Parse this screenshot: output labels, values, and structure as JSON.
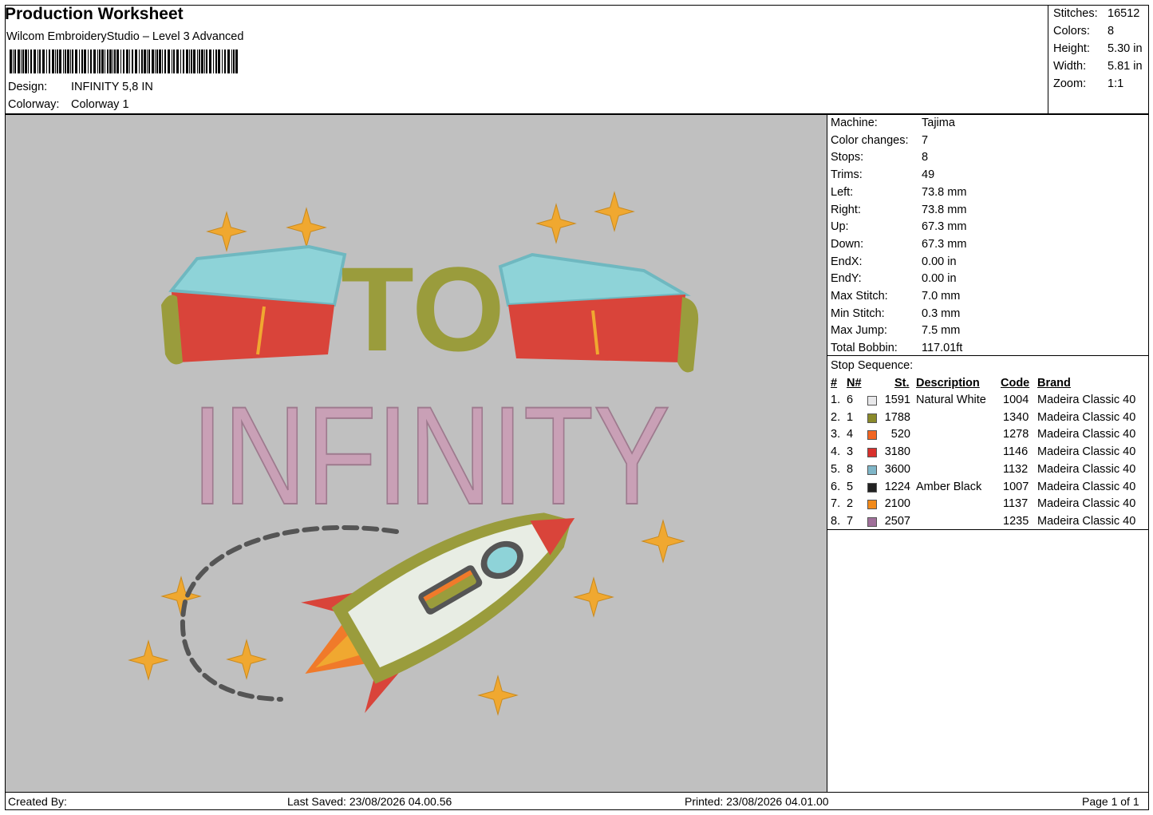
{
  "header": {
    "title": "Production Worksheet",
    "subtitle": "Wilcom EmbroideryStudio – Level 3 Advanced",
    "barcode_text": "*INFINITY 5,8 IN*",
    "design_label": "Design:",
    "design_value": "INFINITY 5,8 IN",
    "colorway_label": "Colorway:",
    "colorway_value": "Colorway 1"
  },
  "summary": [
    {
      "label": "Stitches:",
      "value": "16512"
    },
    {
      "label": "Colors:",
      "value": "8"
    },
    {
      "label": "Height:",
      "value": "5.30 in"
    },
    {
      "label": "Width:",
      "value": "5.81 in"
    },
    {
      "label": "Zoom:",
      "value": "1:1"
    }
  ],
  "design_preview": {
    "text_line1": "TO",
    "text_line2": "INFINITY",
    "background_color": "#c0c0c0",
    "colors": {
      "pink": "#c9a0b6",
      "olive": "#9a9c3c",
      "red": "#d9443a",
      "cyan": "#8ed3d8",
      "gold": "#f0a830",
      "white": "#e8ede4",
      "dark": "#555555",
      "orange": "#f07a2a"
    }
  },
  "machine_info": [
    {
      "label": "Machine:",
      "value": "Tajima"
    },
    {
      "label": "Color changes:",
      "value": "7"
    },
    {
      "label": "Stops:",
      "value": "8"
    },
    {
      "label": "Trims:",
      "value": "49"
    },
    {
      "label": "Left:",
      "value": "73.8 mm"
    },
    {
      "label": "Right:",
      "value": "73.8 mm"
    },
    {
      "label": "Up:",
      "value": "67.3 mm"
    },
    {
      "label": "Down:",
      "value": "67.3 mm"
    },
    {
      "label": "EndX:",
      "value": "0.00 in"
    },
    {
      "label": "EndY:",
      "value": "0.00 in"
    },
    {
      "label": "Max Stitch:",
      "value": "7.0 mm"
    },
    {
      "label": "Min Stitch:",
      "value": "0.3 mm"
    },
    {
      "label": "Max Jump:",
      "value": "7.5 mm"
    },
    {
      "label": "Total Bobbin:",
      "value": "117.01ft"
    }
  ],
  "stop_sequence": {
    "title": "Stop Sequence:",
    "headers": {
      "num": "#",
      "n": "N#",
      "st": "St.",
      "description": "Description",
      "code": "Code",
      "brand": "Brand"
    },
    "rows": [
      {
        "num": "1.",
        "n": "6",
        "color": "#e8e8ea",
        "st": "1591",
        "description": "Natural White",
        "code": "1004",
        "brand": "Madeira Classic 40"
      },
      {
        "num": "2.",
        "n": "1",
        "color": "#8a8a2a",
        "st": "1788",
        "description": "",
        "code": "1340",
        "brand": "Madeira Classic 40"
      },
      {
        "num": "3.",
        "n": "4",
        "color": "#f26522",
        "st": "520",
        "description": "",
        "code": "1278",
        "brand": "Madeira Classic 40"
      },
      {
        "num": "4.",
        "n": "3",
        "color": "#d8302c",
        "st": "3180",
        "description": "",
        "code": "1146",
        "brand": "Madeira Classic 40"
      },
      {
        "num": "5.",
        "n": "8",
        "color": "#7fb6c8",
        "st": "3600",
        "description": "",
        "code": "1132",
        "brand": "Madeira Classic 40"
      },
      {
        "num": "6.",
        "n": "5",
        "color": "#222222",
        "st": "1224",
        "description": "Amber Black",
        "code": "1007",
        "brand": "Madeira Classic 40"
      },
      {
        "num": "7.",
        "n": "2",
        "color": "#f28a1a",
        "st": "2100",
        "description": "",
        "code": "1137",
        "brand": "Madeira Classic 40"
      },
      {
        "num": "8.",
        "n": "7",
        "color": "#a0709a",
        "st": "2507",
        "description": "",
        "code": "1235",
        "brand": "Madeira Classic 40"
      }
    ]
  },
  "footer": {
    "created_by": "Created By:",
    "last_saved": "Last Saved: 23/08/2026 04.00.56",
    "printed": "Printed: 23/08/2026 04.01.00",
    "page": "Page 1 of 1"
  }
}
